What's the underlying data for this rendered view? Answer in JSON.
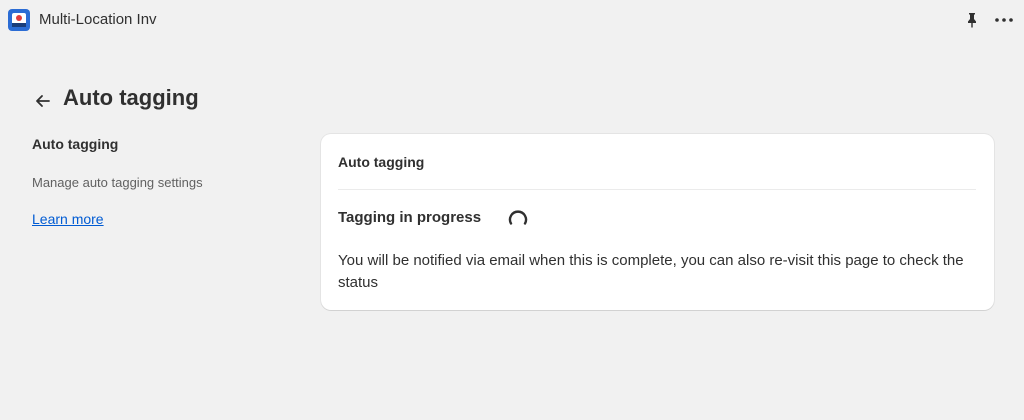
{
  "app": {
    "title": "Multi-Location Inv",
    "logo_icon": "app-logo",
    "actions": [
      {
        "name": "pin",
        "icon": "pin-icon"
      },
      {
        "name": "more",
        "icon": "more-icon"
      }
    ]
  },
  "page": {
    "title": "Auto tagging",
    "back_icon": "arrow-left-icon"
  },
  "sidebar": {
    "heading": "Auto tagging",
    "description": "Manage auto tagging settings",
    "link_label": "Learn more"
  },
  "card": {
    "title": "Auto tagging",
    "status": "Tagging in progress",
    "spinner_icon": "spinner-icon",
    "message": "You will be notified via email when this is complete, you can also re-visit this page to check the status"
  },
  "colors": {
    "background": "#f1f1f1",
    "card": "#ffffff",
    "link": "#005bd3",
    "text": "#303030",
    "muted": "#616161"
  }
}
